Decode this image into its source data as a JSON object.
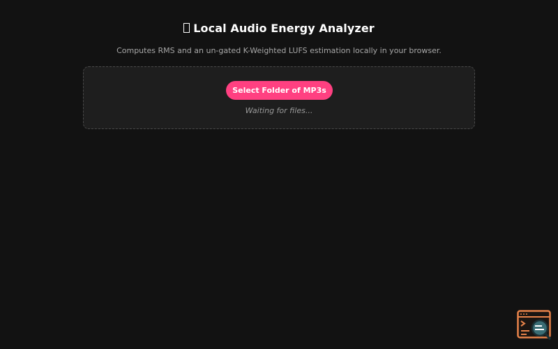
{
  "header": {
    "title": "Local Audio Energy Analyzer",
    "subtitle": "Computes RMS and an un-gated K-Weighted LUFS estimation locally in your browser."
  },
  "drop_zone": {
    "button_label": "Select Folder of MP3s",
    "status": "Waiting for files..."
  },
  "icons": {
    "title_glyph": "missing-glyph-icon",
    "corner_widget": "code-inspect-icon"
  },
  "colors": {
    "background": "#121212",
    "panel": "#1e1e1e",
    "accent": "#ff4081",
    "widget_orange": "#e8834a",
    "widget_teal": "#2f5f66"
  }
}
